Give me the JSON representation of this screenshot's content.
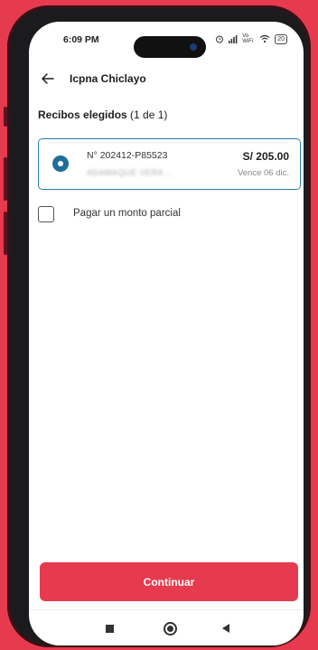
{
  "status": {
    "time": "6:09 PM",
    "network": "Vo WiFi",
    "battery": "20"
  },
  "header": {
    "title": "Icpna Chiclayo"
  },
  "section": {
    "title": "Recibos elegidos",
    "count": "(1 de 1)"
  },
  "receipt": {
    "number": "N° 202412-P85523",
    "name": "ADAMAQUE VERA ...",
    "amount": "S/ 205.00",
    "due": "Vence 06 dic."
  },
  "partial": {
    "label": "Pagar un monto parcial"
  },
  "footer": {
    "continue_label": "Continuar"
  }
}
